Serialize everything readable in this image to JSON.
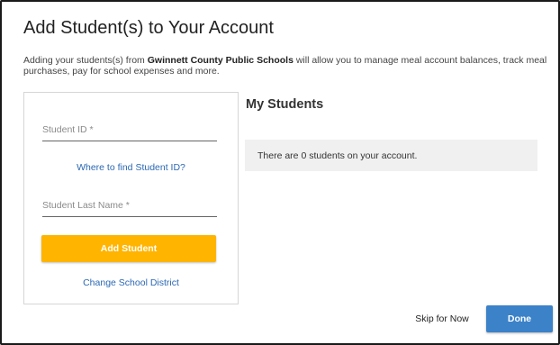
{
  "dialog": {
    "title": "Add Student(s) to Your Account",
    "description": {
      "before": "Adding your students(s) from ",
      "district": "Gwinnett County Public Schools",
      "after": " will allow you to manage meal account balances, track meal purchases, pay for school expenses and more."
    }
  },
  "form": {
    "student_id_placeholder": "Student ID *",
    "student_id_value": "",
    "find_id_link": "Where to find Student ID?",
    "last_name_placeholder": "Student Last Name *",
    "last_name_value": "",
    "add_button": "Add Student",
    "change_district_link": "Change School District"
  },
  "students": {
    "heading": "My Students",
    "empty_message": "There are 0 students on your account."
  },
  "footer": {
    "skip_label": "Skip for Now",
    "done_label": "Done"
  },
  "colors": {
    "accent_yellow": "#ffb400",
    "primary_blue": "#3b82c9",
    "link_blue": "#2b68b3",
    "panel_gray": "#f0f0f0"
  }
}
